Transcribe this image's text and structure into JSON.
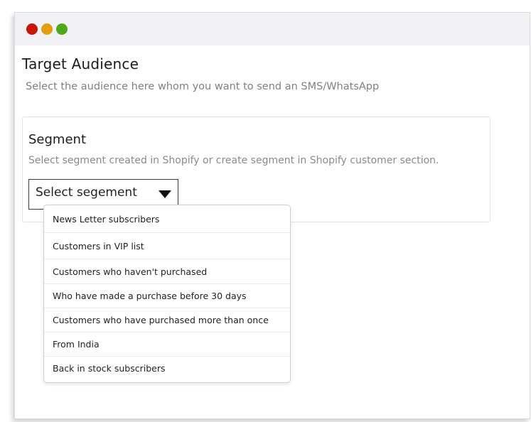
{
  "window": {
    "controls": [
      {
        "name": "close-dot",
        "color": "#c8160b"
      },
      {
        "name": "minimize-dot",
        "color": "#e0a010"
      },
      {
        "name": "maximize-dot",
        "color": "#4caa18"
      }
    ]
  },
  "header": {
    "title": "Target Audience",
    "subtitle": "Select the audience here whom you want to send an SMS/WhatsApp"
  },
  "segment": {
    "title": "Segment",
    "description": "Select segment created in Shopify or create segment in Shopify customer section.",
    "select_label": "Select segement",
    "arrow_icon": "caret-down-icon",
    "options": [
      "News Letter subscribers",
      "Customers in VIP list",
      "Customers who haven't purchased",
      "Who have made a purchase before 30 days",
      "Customers who have purchased more than once",
      "From India",
      "Back in stock subscribers"
    ]
  }
}
